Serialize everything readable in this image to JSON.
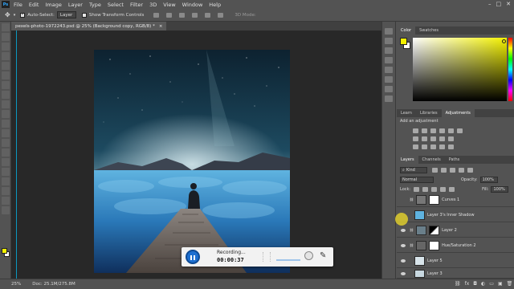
{
  "menu": {
    "logo": "Ps",
    "items": [
      "File",
      "Edit",
      "Image",
      "Layer",
      "Type",
      "Select",
      "Filter",
      "3D",
      "View",
      "Window",
      "Help"
    ]
  },
  "options": {
    "auto_select_label": "Auto-Select:",
    "auto_select_value": "Layer",
    "transform_label": "Show Transform Controls",
    "mode_3d": "3D Mode:"
  },
  "document": {
    "tab_title": "pexels-photo-1972243.psd @ 25% (Background copy, RGB/8) *"
  },
  "status": {
    "zoom": "25%",
    "doc_info": "Doc: 25.1M/275.8M"
  },
  "recorder": {
    "state_label": "Recording...",
    "time": "00:00:37"
  },
  "color_panel": {
    "tabs": [
      "Color",
      "Swatches"
    ],
    "fg_color": "#f4f200",
    "bg_color": "#ffffff"
  },
  "adjust_panel": {
    "tabs": [
      "Learn",
      "Libraries",
      "Adjustments"
    ],
    "hint": "Add an adjustment"
  },
  "layers_panel": {
    "tabs": [
      "Layers",
      "Channels",
      "Paths"
    ],
    "filter_kind": "Kind",
    "blend_mode": "Normal",
    "opacity_label": "Opacity:",
    "opacity_value": "100%",
    "lock_label": "Lock:",
    "fill_label": "Fill:",
    "fill_value": "100%",
    "layers": [
      {
        "name": "Curves 1",
        "visible": false
      },
      {
        "name": "Layer 3's Inner Shadow",
        "visible": false
      },
      {
        "name": "Layer 2",
        "visible": true
      },
      {
        "name": "Hue/Saturation 2",
        "visible": true
      },
      {
        "name": "Layer 5",
        "visible": true
      },
      {
        "name": "Layer 3",
        "visible": true
      }
    ]
  },
  "colors": {
    "accent_blue": "#1d6fd0",
    "guide_cyan": "#00c8ff"
  }
}
